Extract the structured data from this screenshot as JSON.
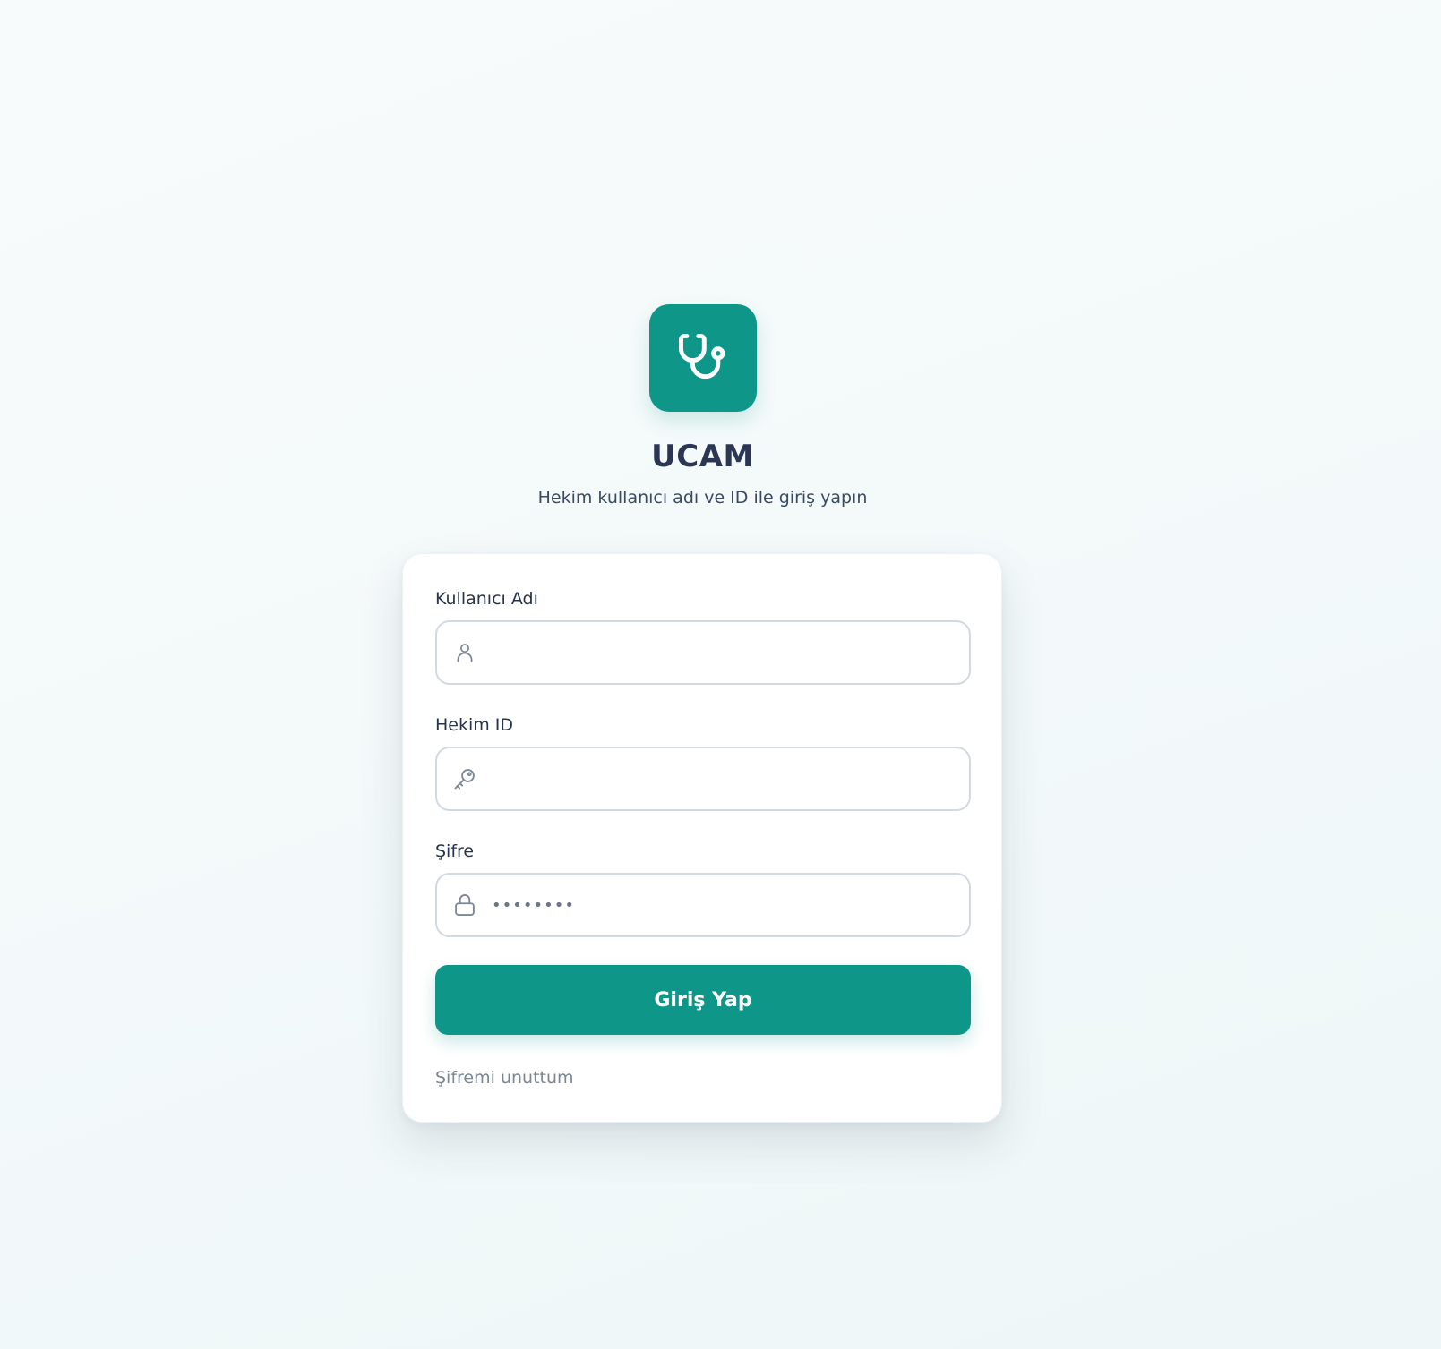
{
  "brand": {
    "title": "UCAM",
    "subtitle": "Hekim kullanıcı adı ve ID ile giriş yapın",
    "logo_icon": "stethoscope-icon",
    "accent_color": "#0e9688"
  },
  "form": {
    "username": {
      "label": "Kullanıcı Adı",
      "value": "",
      "placeholder": "",
      "icon": "user-icon"
    },
    "doctor_id": {
      "label": "Hekim ID",
      "value": "",
      "placeholder": "",
      "icon": "key-icon"
    },
    "password": {
      "label": "Şifre",
      "value": "",
      "placeholder": "••••••••",
      "icon": "lock-icon"
    },
    "submit_label": "Giriş Yap",
    "forgot_password_label": "Şifremi unuttum"
  }
}
